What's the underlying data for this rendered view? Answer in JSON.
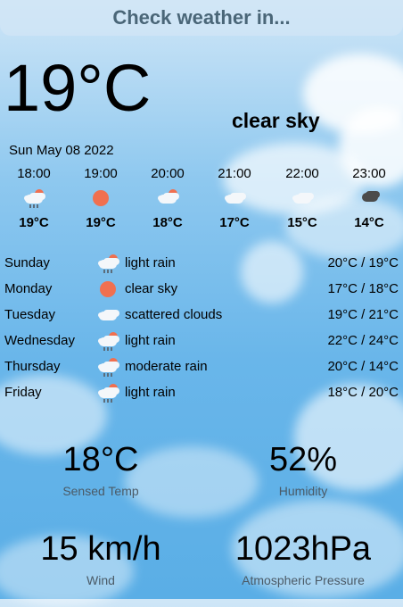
{
  "search": {
    "label": "Check weather in..."
  },
  "current": {
    "temp": "19°C",
    "description": "clear sky",
    "date": "Sun May 08 2022"
  },
  "hourly": [
    {
      "time": "18:00",
      "temp": "19°C",
      "icon": "light-rain-icon"
    },
    {
      "time": "19:00",
      "temp": "19°C",
      "icon": "sun-icon"
    },
    {
      "time": "20:00",
      "temp": "18°C",
      "icon": "partly-cloudy-icon"
    },
    {
      "time": "21:00",
      "temp": "17°C",
      "icon": "cloud-icon"
    },
    {
      "time": "22:00",
      "temp": "15°C",
      "icon": "cloud-icon"
    },
    {
      "time": "23:00",
      "temp": "14°C",
      "icon": "dark-cloud-icon"
    }
  ],
  "daily": [
    {
      "day": "Sunday",
      "condition": "light rain",
      "range": "20°C / 19°C",
      "icon": "light-rain-icon"
    },
    {
      "day": "Monday",
      "condition": "clear sky",
      "range": "17°C / 18°C",
      "icon": "sun-icon"
    },
    {
      "day": "Tuesday",
      "condition": "scattered clouds",
      "range": "19°C / 21°C",
      "icon": "cloud-icon"
    },
    {
      "day": "Wednesday",
      "condition": "light rain",
      "range": "22°C / 24°C",
      "icon": "light-rain-icon"
    },
    {
      "day": "Thursday",
      "condition": "moderate rain",
      "range": "20°C / 14°C",
      "icon": "rain-icon"
    },
    {
      "day": "Friday",
      "condition": "light rain",
      "range": "18°C / 20°C",
      "icon": "light-rain-icon"
    }
  ],
  "stats": {
    "sensed": {
      "value": "18°C",
      "label": "Sensed Temp"
    },
    "humidity": {
      "value": "52%",
      "label": "Humidity"
    },
    "wind": {
      "value": "15 km/h",
      "label": "Wind"
    },
    "pressure": {
      "value": "1023hPa",
      "label": "Atmospheric Pressure"
    }
  },
  "colors": {
    "sun": "#f07050",
    "sky_top": "#cfe6f7",
    "sky_bottom": "#5aaee6",
    "search_text": "#4a6678"
  }
}
